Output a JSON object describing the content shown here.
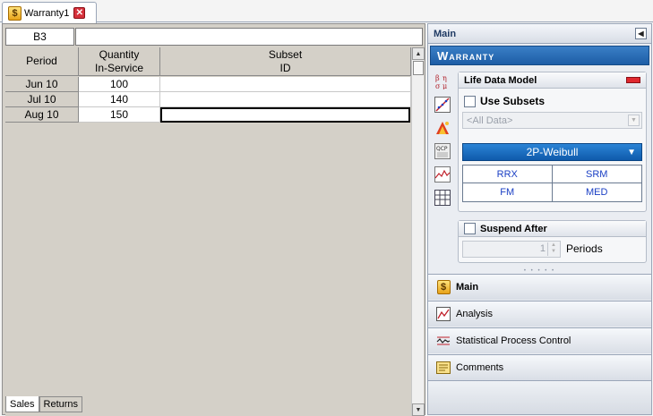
{
  "document_tab": {
    "label": "Warranty1",
    "icon": "dollar-icon",
    "close_icon": "close-icon"
  },
  "cell_reference": "B3",
  "formula_value": "",
  "grid": {
    "headers": [
      "Period",
      "Quantity\nIn-Service",
      "Subset\nID"
    ],
    "header_period": "Period",
    "header_qty_1": "Quantity",
    "header_qty_2": "In-Service",
    "header_subset_1": "Subset",
    "header_subset_2": "ID",
    "rows": [
      {
        "period": "Jun 10",
        "quantity": "100",
        "subset": ""
      },
      {
        "period": "Jul 10",
        "quantity": "140",
        "subset": ""
      },
      {
        "period": "Aug 10",
        "quantity": "150",
        "subset": ""
      }
    ],
    "selected_cell": "B3"
  },
  "sheet_tabs": [
    {
      "label": "Sales",
      "active": true
    },
    {
      "label": "Returns",
      "active": false
    }
  ],
  "right_panel": {
    "header": "Main",
    "banner": "Warranty",
    "side_icons": [
      "distribution-plot-icon",
      "probability-plot-icon",
      "life-test-icon",
      "qcp-icon",
      "chart-icon",
      "data-table-icon"
    ],
    "life_data_model": {
      "title": "Life Data Model",
      "use_subsets_label": "Use Subsets",
      "subset_placeholder": "<All Data>",
      "distribution": "2P-Weibull",
      "methods": [
        "RRX",
        "SRM",
        "FM",
        "MED"
      ]
    },
    "suspend_after": {
      "title": "Suspend After",
      "periods_value": "1",
      "periods_label": "Periods"
    },
    "nav": [
      {
        "label": "Main",
        "icon": "dollar-icon",
        "active": true
      },
      {
        "label": "Analysis",
        "icon": "analysis-icon",
        "active": false
      },
      {
        "label": "Statistical Process Control",
        "icon": "spc-icon",
        "active": false
      },
      {
        "label": "Comments",
        "icon": "comments-icon",
        "active": false
      }
    ]
  },
  "colors": {
    "banner": "#1d5da6",
    "distribution_button": "#0f5aab",
    "method_text": "#1a3fc4",
    "close_red": "#d6313b"
  }
}
